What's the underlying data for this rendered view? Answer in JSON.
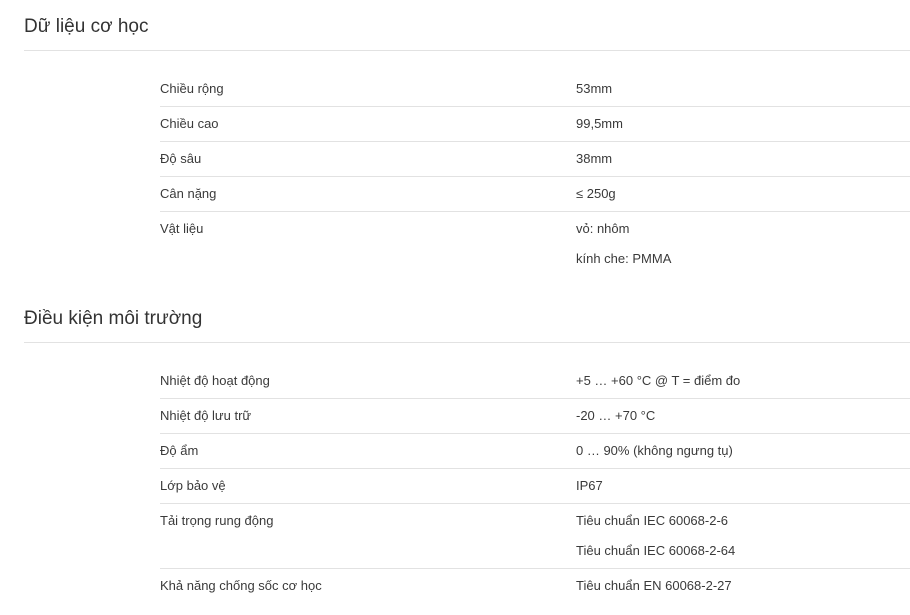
{
  "mechanical": {
    "title": "Dữ liệu cơ học",
    "rows": [
      {
        "label": "Chiều rộng",
        "values": [
          "53mm"
        ]
      },
      {
        "label": "Chiều cao",
        "values": [
          "99,5mm"
        ]
      },
      {
        "label": "Độ sâu",
        "values": [
          "38mm"
        ]
      },
      {
        "label": "Cân nặng",
        "values": [
          "≤ 250g"
        ]
      },
      {
        "label": "Vật liệu",
        "values": [
          "vỏ: nhôm",
          "kính che: PMMA"
        ]
      }
    ]
  },
  "environment": {
    "title": "Điều kiện môi trường",
    "rows": [
      {
        "label": "Nhiệt độ hoạt động",
        "values": [
          "+5 … +60 °C @ T = điểm đo"
        ]
      },
      {
        "label": "Nhiệt độ lưu trữ",
        "values": [
          "-20 … +70 °C"
        ]
      },
      {
        "label": "Độ ẩm",
        "values": [
          "0 … 90% (không ngưng tụ)"
        ]
      },
      {
        "label": "Lớp bảo vệ",
        "values": [
          "IP67"
        ]
      },
      {
        "label": "Tải trọng rung động",
        "values": [
          "Tiêu chuẩn IEC 60068-2-6",
          "Tiêu chuẩn IEC 60068-2-64"
        ]
      },
      {
        "label": "Khả năng chống sốc cơ học",
        "values": [
          "Tiêu chuẩn EN 60068-2-27"
        ]
      }
    ]
  }
}
